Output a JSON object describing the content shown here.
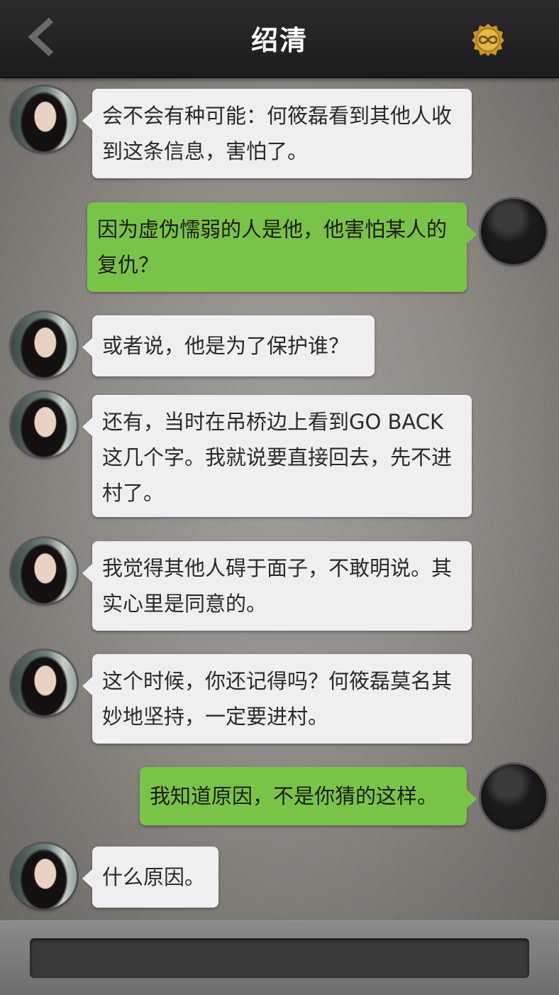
{
  "header": {
    "title": "绍清",
    "back_icon": "chevron-left-icon",
    "badge_icon": "infinity-coin-icon",
    "badge_color": "#d9a93a"
  },
  "messages": [
    {
      "side": "in",
      "text": "会不会有种可能：何筱磊看到其他人收到这条信息，害怕了。"
    },
    {
      "side": "out",
      "text": "因为虚伪懦弱的人是他，他害怕某人的复仇？"
    },
    {
      "side": "in",
      "text": "或者说，他是为了保护谁？"
    },
    {
      "side": "in",
      "text": "还有，当时在吊桥边上看到GO BACK这几个字。我就说要直接回去，先不进村了。"
    },
    {
      "side": "in",
      "text": "我觉得其他人碍于面子，不敢明说。其实心里是同意的。"
    },
    {
      "side": "in",
      "text": "这个时候，你还记得吗？何筱磊莫名其妙地坚持，一定要进村。"
    },
    {
      "side": "out",
      "text": "我知道原因，不是你猜的这样。"
    },
    {
      "side": "in",
      "text": "什么原因。"
    }
  ],
  "composer": {
    "value": "",
    "placeholder": ""
  },
  "colors": {
    "incoming_bubble": "#efefef",
    "outgoing_bubble": "#7ac349",
    "topbar": "#222222"
  }
}
